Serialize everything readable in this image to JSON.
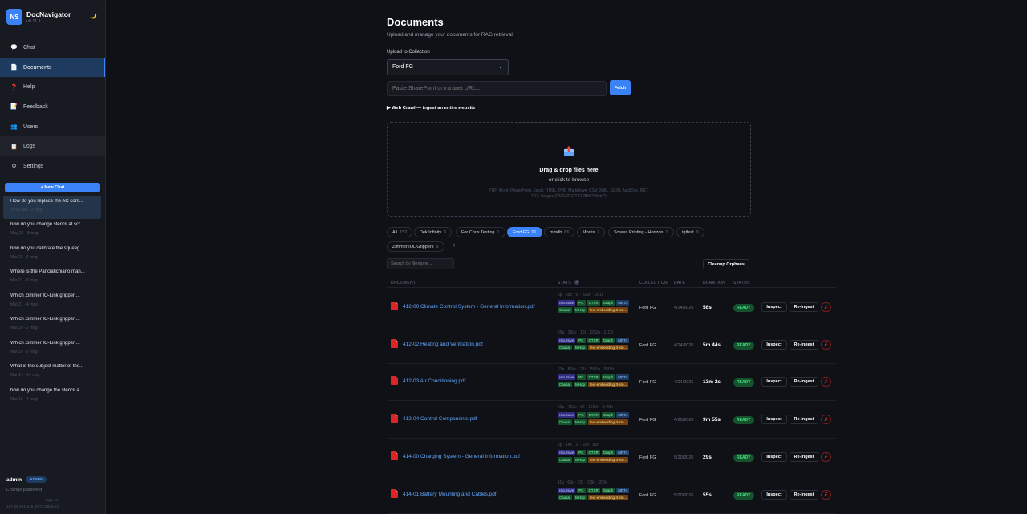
{
  "app": {
    "name": "DocNavigator",
    "version": "v0.11.1",
    "logo_text": "NS",
    "theme_icon": "moon-icon"
  },
  "nav": [
    {
      "label": "Chat",
      "icon": "chat-bubble-icon",
      "glyph": "💬"
    },
    {
      "label": "Documents",
      "icon": "document-icon",
      "glyph": "📄"
    },
    {
      "label": "Help",
      "icon": "question-icon",
      "glyph": "❓"
    },
    {
      "label": "Feedback",
      "icon": "feedback-icon",
      "glyph": "📝"
    },
    {
      "label": "Users",
      "icon": "users-icon",
      "glyph": "👥"
    },
    {
      "label": "Logs",
      "icon": "logs-icon",
      "glyph": "📋"
    },
    {
      "label": "Settings",
      "icon": "gear-icon",
      "glyph": "⚙"
    }
  ],
  "new_chat_label": "+ New Chat",
  "chats": [
    {
      "title": "How do you replace the AC com...",
      "meta": "10:53 AM · 2 msg"
    },
    {
      "title": "how do you change stencil at scr...",
      "meta": "May 26 · 8 msg"
    },
    {
      "title": "how do you calibrate the squeeg...",
      "meta": "Mar 22 · 6 msg"
    },
    {
      "title": "Where is the Panciatichiano man...",
      "meta": "Mar 21 · 6 msg"
    },
    {
      "title": "Which Zimmer IO-Link gripper ...",
      "meta": "Mar 21 · 4 msg"
    },
    {
      "title": "Which Zimmer IO-Link gripper ...",
      "meta": "Mar 20 · 2 msg"
    },
    {
      "title": "Which Zimmer IO-Link gripper ...",
      "meta": "Mar 19 · 6 msg"
    },
    {
      "title": "What is the subject matter of the...",
      "meta": "Mar 14 · 14 msg"
    },
    {
      "title": "how do you change the stencil a...",
      "meta": "Mar 12 · 4 msg"
    }
  ],
  "footer": {
    "user": "admin",
    "role": "ADMIN",
    "change_password": "Change password",
    "session_label": "Sign out",
    "ip": "167.55.101.245.80/72.86(Sun)"
  },
  "page": {
    "title": "Documents",
    "subtitle": "Upload and manage your documents for RAG retrieval.",
    "upload_label": "Upload to Collection",
    "collection_selected": "Ford FG",
    "url_placeholder": "Paste SharePoint or intranet URL...",
    "fetch_label": "Fetch",
    "crawl_label": "▶ Web Crawl — ingest an entire website",
    "drop_title": "Drag & drop files here",
    "drop_sub": "or click to browse",
    "drop_types_1": "PDF, Word, PowerPoint, Excel, HTML, PHP, Markdown, CSV, XML, JSON, AsciiDoc, RST,",
    "drop_types_2": "TXT, Images (PNG/JPG/TIFF/BMP/WebP)",
    "search_placeholder": "Search by filename...",
    "cleanup_label": "Cleanup Orphans"
  },
  "tabs": [
    {
      "label": "All",
      "count": "152"
    },
    {
      "label": "Dek Infinity",
      "count": "6"
    },
    {
      "label": "For Chris Testing",
      "count": "1"
    },
    {
      "label": "Ford FG",
      "count": "91"
    },
    {
      "label": "mmdb",
      "count": "66"
    },
    {
      "label": "Morris",
      "count": "2"
    },
    {
      "label": "Screen Printing - Horizon",
      "count": "1"
    },
    {
      "label": "tgltest",
      "count": "0"
    },
    {
      "label": "Zimmer IOL Grippers",
      "count": "5"
    }
  ],
  "add_tab_label": "+",
  "table": {
    "headers": {
      "document": "DOCUMENT",
      "stats": "STATS",
      "collection": "COLLECTION",
      "date": "DATE",
      "duration": "DURATION",
      "status": "STATUS"
    },
    "info_icon": "?",
    "badges": [
      "recursive",
      "PC",
      "CTXR",
      "Graph",
      "META",
      "Causal",
      "MHop",
      "text-embedding-3-sm..."
    ],
    "inspect_label": "Inspect",
    "reingest_label": "Re-ingest",
    "delete_label": "✗",
    "rows": [
      {
        "name": "412-00 Climate Control System - General Information.pdf",
        "stats": "5p · 55c · 5i · 322n · 251r",
        "collection": "Ford FG",
        "date": "4/24/2026",
        "duration": "58s",
        "status": "READY"
      },
      {
        "name": "412-02 Heating and Ventilation.pdf",
        "stats": "29p · 360c · 13i · 1252n · 1112r",
        "collection": "Ford FG",
        "date": "4/24/2026",
        "duration": "5m 44s",
        "status": "READY"
      },
      {
        "name": "412-03 Air Conditioning.pdf",
        "stats": "63p · 824c · 21i · 3581n · 3508r",
        "collection": "Ford FG",
        "date": "4/24/2026",
        "duration": "13m 2s",
        "status": "READY"
      },
      {
        "name": "412-04 Control Components.pdf",
        "stats": "50p · 412c · 66 · 1664n · 1495r",
        "collection": "Ford FG",
        "date": "4/25/2026",
        "duration": "9m 55s",
        "status": "READY"
      },
      {
        "name": "414-00 Charging System - General Information.pdf",
        "stats": "2p · 14c · 2i · 91n · 82r",
        "collection": "Ford FG",
        "date": "5/20/2026",
        "duration": "29s",
        "status": "READY"
      },
      {
        "name": "414-01 Battery Mounting and Cables.pdf",
        "stats": "11p · 69c · 23i · 239n · 209r",
        "collection": "Ford FG",
        "date": "5/20/2026",
        "duration": "55s",
        "status": "READY"
      }
    ]
  },
  "colors": {
    "accent": "#3b82f6",
    "bg": "#0f1117",
    "sidebar": "#171a21",
    "ready": "#4ade80",
    "danger": "#ef4444"
  }
}
